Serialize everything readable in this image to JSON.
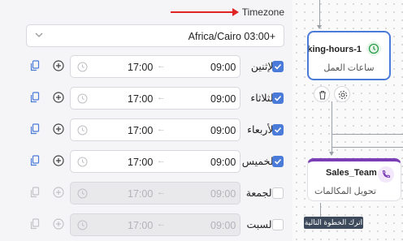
{
  "timezone": {
    "label": "Timezone",
    "value": "Africa/Cairo 03:00+"
  },
  "days": [
    {
      "name": "الإثنين",
      "enabled": true,
      "start": "09:00",
      "end": "17:00"
    },
    {
      "name": "الثلاثاء",
      "enabled": true,
      "start": "09:00",
      "end": "17:00"
    },
    {
      "name": "الأربعاء",
      "enabled": true,
      "start": "09:00",
      "end": "17:00"
    },
    {
      "name": "الخميس",
      "enabled": true,
      "start": "09:00",
      "end": "17:00"
    },
    {
      "name": "الجمعة",
      "enabled": false,
      "start": "09:00",
      "end": "17:00"
    },
    {
      "name": "السبت",
      "enabled": false,
      "start": "09:00",
      "end": "17:00"
    }
  ],
  "flow": {
    "working_hours_node": {
      "title": "king-hours-1",
      "subtitle": "ساعات العمل"
    },
    "sales_node": {
      "title": "Sales_Team",
      "subtitle": "تحويل المكالمات"
    },
    "tooltip": "اترك الخطوة التالية"
  },
  "colors": {
    "accent": "#4a7bd8",
    "arrow": "#e02424",
    "sales_accent": "#7b3fb5",
    "clock_green": "#2e9d4a"
  },
  "icons": {
    "copy": "copy-icon",
    "add": "plus-circle-icon",
    "clock": "clock-icon",
    "check": "check-icon",
    "chevron": "chevron-down-icon",
    "delete": "trash-icon",
    "settings": "gear-icon",
    "phone": "phone-icon"
  }
}
